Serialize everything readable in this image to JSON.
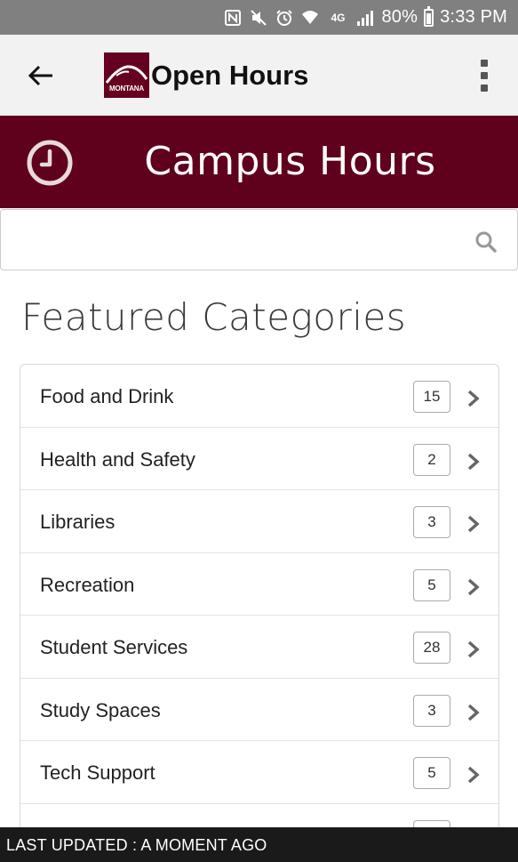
{
  "status_bar": {
    "icons": [
      "nfc-icon",
      "mute-icon",
      "alarm-icon",
      "wifi-icon",
      "lte-icon",
      "signal-icon"
    ],
    "lte_label": "4G",
    "battery": "80%",
    "time": "3:33 PM"
  },
  "app_bar": {
    "title": "Open Hours",
    "logo_text": "MONTANA"
  },
  "banner": {
    "title": "Campus Hours"
  },
  "search": {
    "value": "",
    "placeholder": ""
  },
  "section": {
    "title": "Featured Categories"
  },
  "categories": [
    {
      "label": "Food and Drink",
      "count": "15"
    },
    {
      "label": "Health and Safety",
      "count": "2"
    },
    {
      "label": "Libraries",
      "count": "3"
    },
    {
      "label": "Recreation",
      "count": "5"
    },
    {
      "label": "Student Services",
      "count": "28"
    },
    {
      "label": "Study Spaces",
      "count": "3"
    },
    {
      "label": "Tech Support",
      "count": "5"
    },
    {
      "label": "",
      "count": ""
    }
  ],
  "footer": {
    "text": "LAST UPDATED : A MOMENT AGO"
  },
  "colors": {
    "brand": "#5f001d",
    "status_bar": "#808080",
    "app_bar": "#f2f2f2",
    "footer": "#1a1a1a"
  }
}
